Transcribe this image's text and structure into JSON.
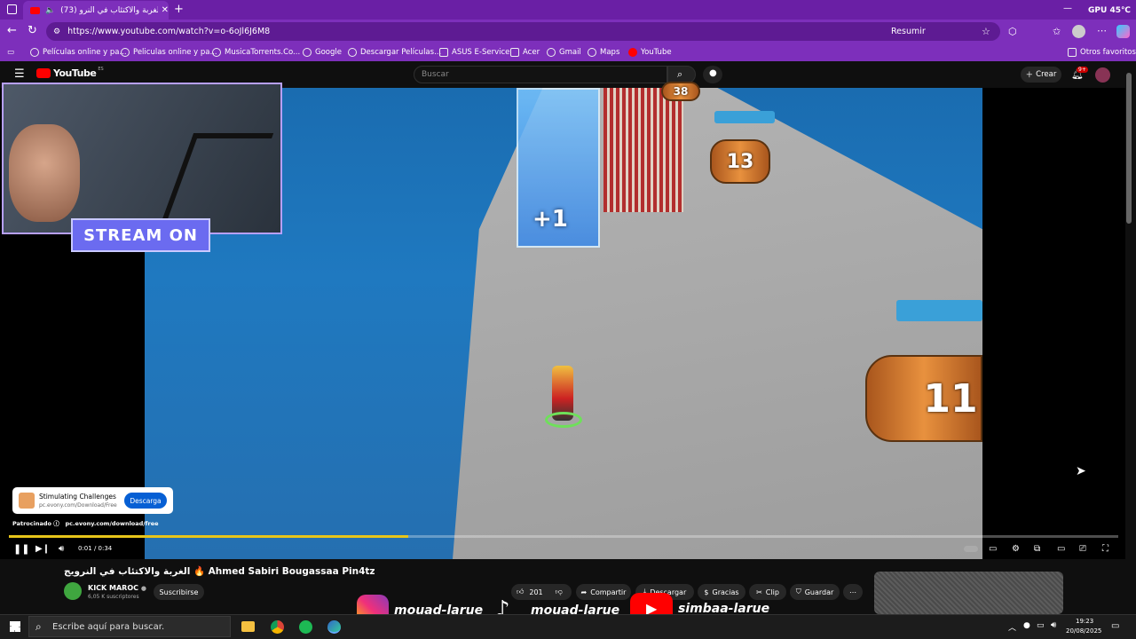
{
  "browser": {
    "tab_title": "(73) الغربة والاكتئاب في النرو...",
    "url": "https://www.youtube.com/watch?v=o-6oJl6J6M8",
    "resumir": "Resumir",
    "gpu_label": "GPU",
    "gpu_value": "45℃"
  },
  "bookmarks": {
    "items": [
      "Películas online y pa...",
      "Peliculas online y pa...",
      "MusicaTorrents.Co...",
      "Google",
      "Descargar Películas...",
      "ASUS E-Service",
      "Acer",
      "Gmail",
      "Maps",
      "YouTube"
    ],
    "otros": "Otros favoritos"
  },
  "youtube": {
    "logo": "YouTube",
    "region": "ES",
    "search_placeholder": "Buscar",
    "create_label": "Crear",
    "notif_count": "9+"
  },
  "overlay": {
    "stream_label": "STREAM ON",
    "plus_one": "+1",
    "barrel_1": "38",
    "barrel_2": "13",
    "barrel_3": "11"
  },
  "ad": {
    "title": "Stimulating Challenges",
    "url": "pc.evony.com/Download/Free",
    "button": "Descarga",
    "sponsored": "Patrocinado",
    "sponsor_url": "pc.evony.com/download/free"
  },
  "player": {
    "time": "0:01 / 0:34",
    "progress": 0.36
  },
  "video": {
    "title": "الغربة والاكتئاب في النرويج 🔥 Ahmed Sabiri Bougassaa Pin4tz",
    "channel": "KICK MAROC",
    "subscribers": "6,05 K suscriptores",
    "subscribe": "Suscribirse",
    "likes": "201",
    "share": "Compartir",
    "download": "Descargar",
    "thanks": "Gracias",
    "clip": "Clip",
    "save": "Guardar"
  },
  "social": {
    "instagram": "mouad-larue",
    "tiktok": "mouad-larue",
    "youtube": "simbaa-larue"
  },
  "taskbar": {
    "search": "Escribe aquí para buscar.",
    "time": "19:23",
    "date": "20/08/2025"
  },
  "colors": {
    "browser_accent": "#7d2fbb",
    "yt_red": "#ff0000",
    "progress": "#e7c51a",
    "subscribe_btn": "#272727",
    "ad_btn": "#065fd4"
  }
}
